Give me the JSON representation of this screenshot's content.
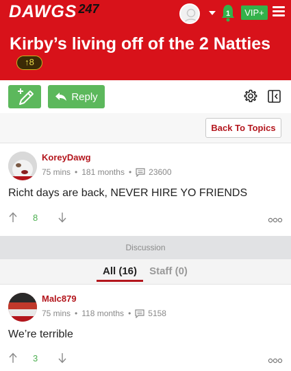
{
  "header": {
    "logo_text": "DAWGS",
    "logo_number": "247",
    "notification_count": "1",
    "vip_label": "VIP+"
  },
  "thread": {
    "title": "Kirby’s living off of the 2 Natties",
    "votes": "8"
  },
  "toolbar": {
    "reply_label": "Reply",
    "back_label": "Back To Topics"
  },
  "posts": [
    {
      "username": "KoreyDawg",
      "time": "75 mins",
      "tenure": "181 months",
      "post_count": "23600",
      "body": "Richt days are back, NEVER HIRE YO FRIENDS",
      "votes": "8"
    },
    {
      "username": "Malc879",
      "time": "75 mins",
      "tenure": "118 months",
      "post_count": "5158",
      "body": "We’re terrible",
      "votes": "3"
    }
  ],
  "discussion": {
    "label": "Discussion",
    "tabs": [
      {
        "label": "All (16)",
        "active": true
      },
      {
        "label": "Staff (0)",
        "active": false
      }
    ]
  },
  "colors": {
    "brand_red": "#d8121a",
    "accent_green": "#5cb85c",
    "username_red": "#b3151c",
    "vip_green": "#33b24a"
  }
}
